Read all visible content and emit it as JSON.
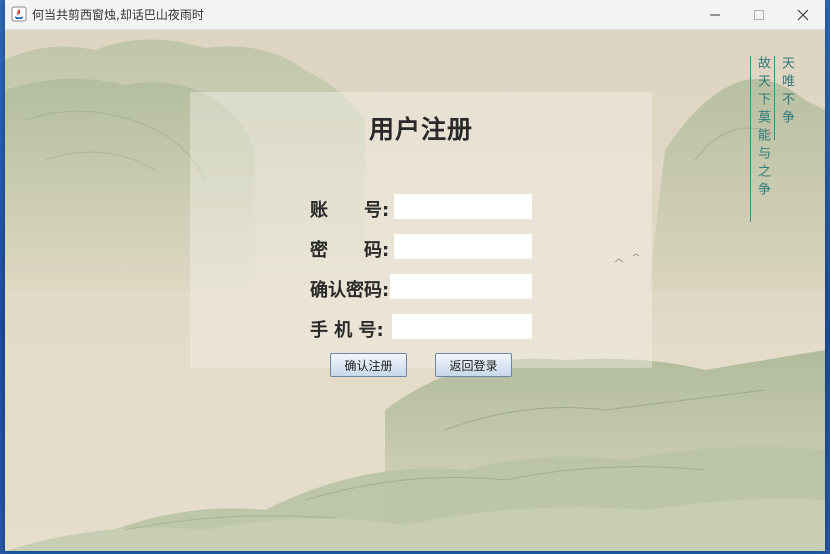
{
  "window": {
    "title": "何当共剪西窗烛,却话巴山夜雨时"
  },
  "form": {
    "title": "用户注册",
    "fields": [
      {
        "label": "账　　号:",
        "value": ""
      },
      {
        "label": "密　　码:",
        "value": ""
      },
      {
        "label": "确认密码:",
        "value": ""
      },
      {
        "label": "手 机 号:",
        "value": ""
      }
    ],
    "confirm_button": "确认注册",
    "back_button": "返回登录"
  },
  "poem": {
    "col1": "天唯不争",
    "col2": "故天下莫能与之争"
  },
  "colors": {
    "background": "#e6dccb",
    "mountain_green": "#a9b893",
    "poem_teal": "#2f7a78"
  }
}
